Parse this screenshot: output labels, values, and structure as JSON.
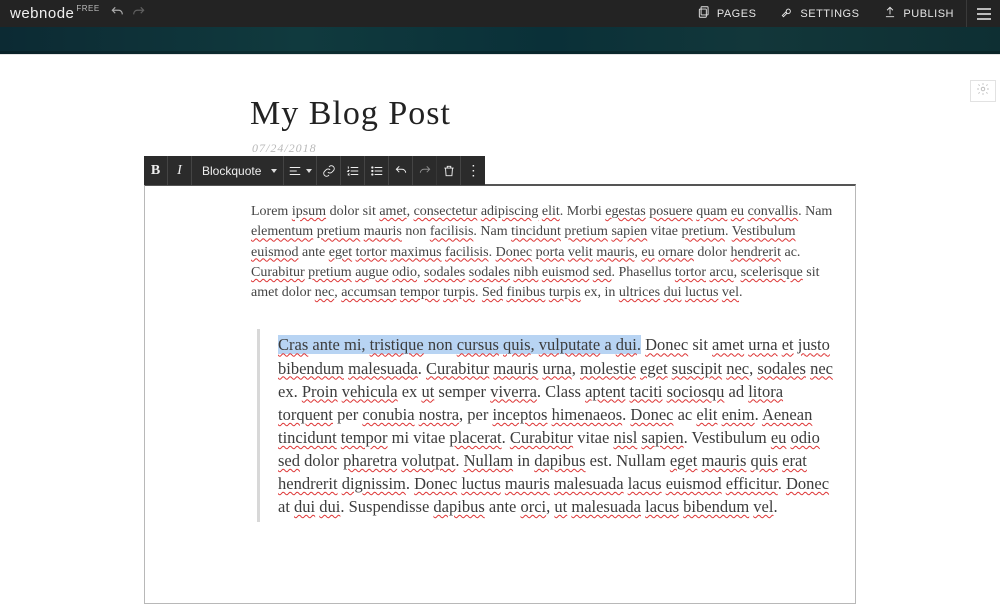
{
  "brand": {
    "name": "webnode",
    "tier": "FREE"
  },
  "topnav": {
    "pages": "PAGES",
    "settings": "SETTINGS",
    "publish": "PUBLISH"
  },
  "post": {
    "title": "My Blog Post",
    "date": "07/24/2018"
  },
  "toolbar": {
    "blockquote": "Blockquote"
  },
  "content": {
    "para_html": "Lorem <span class='sp'>ipsum</span> dolor sit <span class='sp'>amet</span>, <span class='sp'>consectetur</span> <span class='sp'>adipiscing</span> <span class='sp'>elit</span>. Morbi <span class='sp'>egestas</span> <span class='sp'>posuere</span> <span class='sp'>quam</span> <span class='sp'>eu</span> <span class='sp'>convallis</span>. Nam <span class='sp'>elementum</span> <span class='sp'>pretium</span> <span class='sp'>mauris</span> non <span class='sp'>facilisis</span>. Nam <span class='sp'>tincidunt</span> <span class='sp'>pretium</span> <span class='sp'>sapien</span> vitae <span class='sp'>pretium</span>. <span class='sp'>Vestibulum</span> <span class='sp'>euismod</span> ante <span class='sp'>eget</span> <span class='sp'>tortor</span> <span class='sp'>maximus</span> <span class='sp'>facilisis</span>. <span class='sp'>Donec</span> <span class='sp'>porta</span> <span class='sp'>velit</span> <span class='sp'>mauris</span>, <span class='sp'>eu</span> <span class='sp'>ornare</span> dolor <span class='sp'>hendrerit</span> ac. <span class='sp'>Curabitur</span> <span class='sp'>pretium</span> <span class='sp'>augue</span> <span class='sp'>odio</span>, <span class='sp'>sodales</span> <span class='sp'>sodales</span> <span class='sp'>nibh</span> <span class='sp'>euismod</span> <span class='sp'>sed</span>. Phasellus <span class='sp'>tortor</span> <span class='sp'>arcu</span>, <span class='sp'>scelerisque</span> sit amet dolor <span class='sp'>nec</span>, <span class='sp'>accumsan</span> <span class='sp'>tempor</span> <span class='sp'>turpis</span>. <span class='sp'>Sed</span> <span class='sp'>finibus</span> <span class='sp'>turpis</span> ex, in <span class='sp'>ultrices</span> <span class='sp'>dui</span> <span class='sp'>luctus</span> <span class='sp'>vel</span>.",
    "quote_html": "<span class='hl'><span class='sp'>Cras</span> ante mi, <span class='sp'>tristique</span> non <span class='sp'>cursus</span> <span class='sp'>quis</span>, <span class='sp'>vulputate</span> a <span class='sp'>dui</span>.</span> <span class='sp'>Donec</span> sit <span class='sp'>amet</span> <span class='sp'>urna</span> <span class='sp'>et</span> <span class='sp'>justo</span> <span class='sp'>bibendum</span> <span class='sp'>malesuada</span>. <span class='sp'>Curabitur</span> <span class='sp'>mauris</span> <span class='sp'>urna</span>, <span class='sp'>molestie</span> <span class='sp'>eget</span> <span class='sp'>suscipit</span> <span class='sp'>nec</span>, <span class='sp'>sodales</span> <span class='sp'>nec</span> ex. <span class='sp'>Proin</span> <span class='sp'>vehicula</span> ex <span class='sp'>ut</span> semper <span class='sp'>viverra</span>. Class <span class='sp'>aptent</span> <span class='sp'>taciti</span> <span class='sp'>sociosqu</span> ad <span class='sp'>litora</span> <span class='sp'>torquent</span> per <span class='sp'>conubia</span> <span class='sp'>nostra</span>, per <span class='sp'>inceptos</span> <span class='sp'>himenaeos</span>. <span class='sp'>Donec</span> ac <span class='sp'>elit</span> <span class='sp'>enim</span>. <span class='sp'>Aenean</span> <span class='sp'>tincidunt</span> <span class='sp'>tempor</span> mi vitae <span class='sp'>placerat</span>. <span class='sp'>Curabitur</span> vitae <span class='sp'>nisl</span> <span class='sp'>sapien</span>. Vestibulum <span class='sp'>eu</span> <span class='sp'>odio</span> <span class='sp'>sed</span> dolor <span class='sp'>pharetra</span> <span class='sp'>volutpat</span>. <span class='sp'>Nullam</span> in <span class='sp'>dapibus</span> est. Nullam <span class='sp'>eget</span> <span class='sp'>mauris</span> <span class='sp'>quis</span> <span class='sp'>erat</span> <span class='sp'>hendrerit</span> <span class='sp'>dignissim</span>. <span class='sp'>Donec</span> <span class='sp'>luctus</span> <span class='sp'>mauris</span> <span class='sp'>malesuada</span> <span class='sp'>lacus</span> <span class='sp'>euismod</span> <span class='sp'>efficitur</span>. <span class='sp'>Donec</span> at <span class='sp'>dui</span> <span class='sp'>dui</span>. Suspendisse <span class='sp'>dapibus</span> ante <span class='sp'>orci</span>, <span class='sp'>ut</span> <span class='sp'>malesuada</span> <span class='sp'>lacus</span> <span class='sp'>bibendum</span> <span class='sp'>vel</span>."
  }
}
